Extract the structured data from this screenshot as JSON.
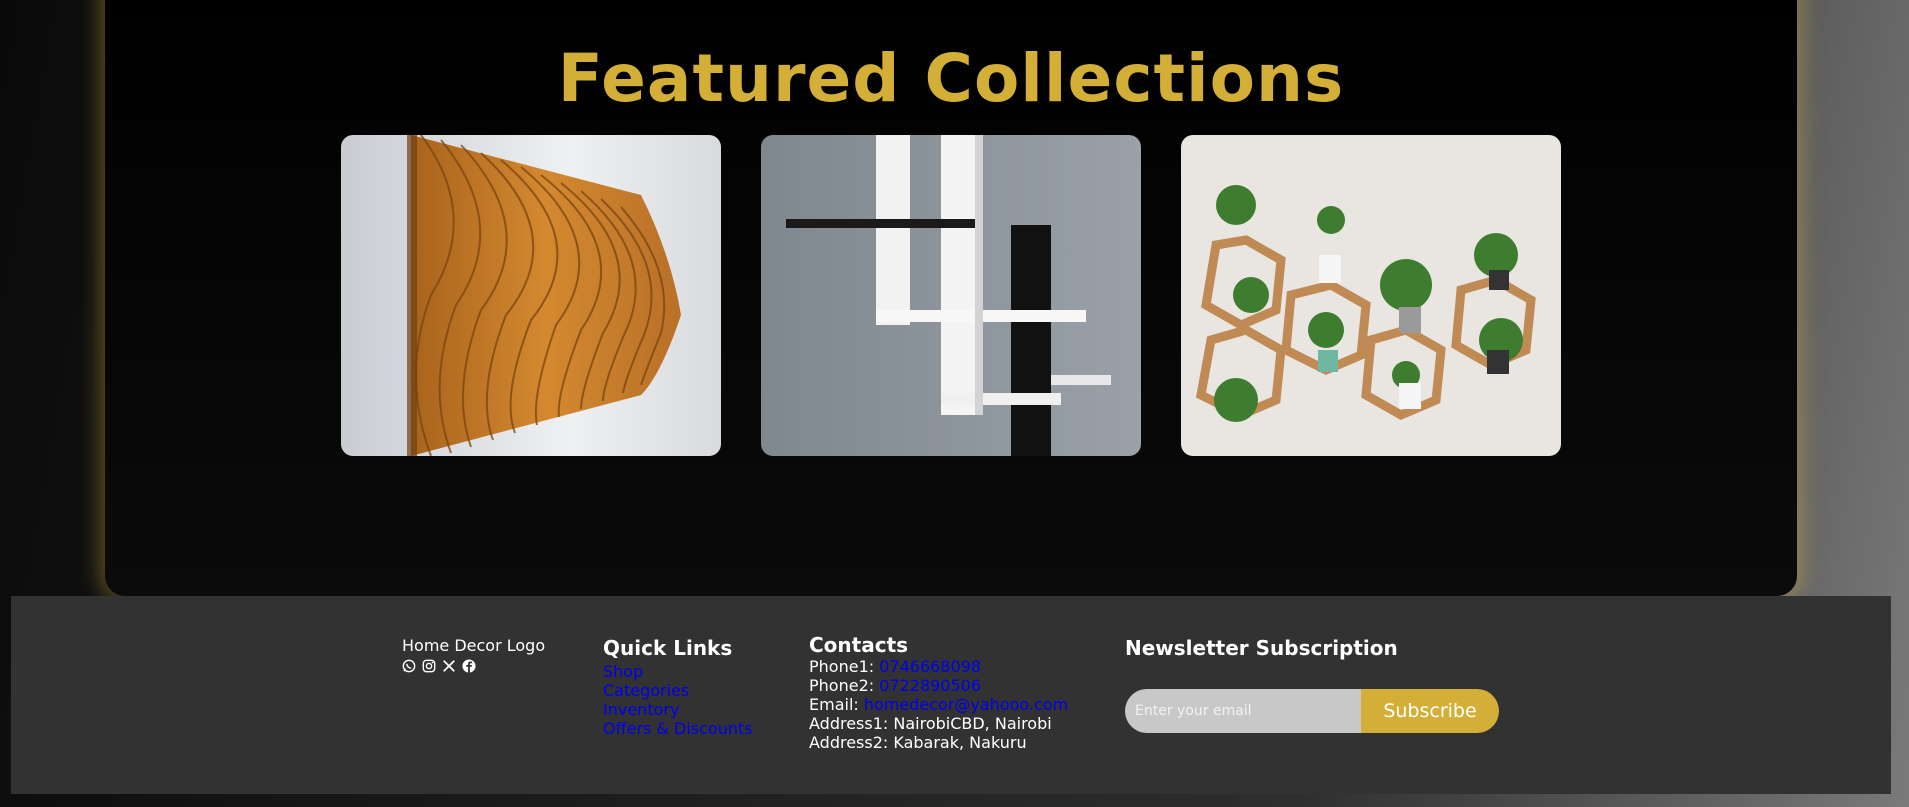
{
  "featured": {
    "title": "Featured Collections",
    "cards": [
      {
        "image": "orange-parametric-wood-wall-art"
      },
      {
        "image": "white-black-wall-shelves"
      },
      {
        "image": "hexagon-plant-shelves"
      }
    ]
  },
  "footer": {
    "logo_text": "Home Decor Logo",
    "socials": [
      "whatsapp-icon",
      "instagram-icon",
      "x-icon",
      "facebook-icon"
    ],
    "quick_links": {
      "title": "Quick Links",
      "items": [
        "Shop",
        "Categories",
        "Inventory",
        "Offers & Discounts"
      ]
    },
    "contacts": {
      "title": "Contacts",
      "phone1_label": "Phone1: ",
      "phone1": "0746668098",
      "phone2_label": "Phone2: ",
      "phone2": "0722890506",
      "email_label": "Email: ",
      "email": "homedecor@yahooo.com",
      "address1": "Address1: NairobiCBD, Nairobi",
      "address2": "Address2: Kabarak, Nakuru"
    },
    "newsletter": {
      "title": "Newsletter Subscription",
      "placeholder": "Enter your email",
      "button": "Subscribe"
    }
  },
  "colors": {
    "accent": "#d4af37",
    "footer_bg": "#323232",
    "link": "#0000ee"
  }
}
